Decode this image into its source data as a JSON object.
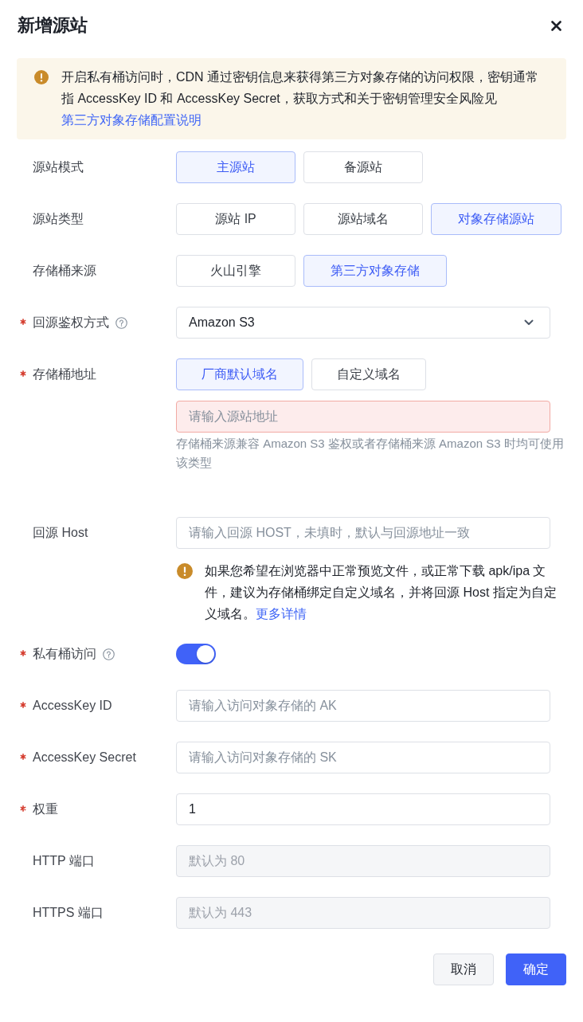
{
  "dialog": {
    "title": "新增源站"
  },
  "notice": {
    "text": "开启私有桶访问时，CDN 通过密钥信息来获得第三方对象存储的访问权限，密钥通常指 AccessKey ID 和 AccessKey Secret，获取方式和关于密钥管理安全风险见",
    "link": "第三方对象存储配置说明"
  },
  "fields": [
    {
      "kind": "segmented",
      "label": "源站模式",
      "required": false,
      "help": false,
      "options": [
        {
          "label": "主源站",
          "selected": true
        },
        {
          "label": "备源站",
          "selected": false
        }
      ]
    },
    {
      "kind": "segmented",
      "label": "源站类型",
      "required": false,
      "help": false,
      "options": [
        {
          "label": "源站 IP",
          "selected": false
        },
        {
          "label": "源站域名",
          "selected": false
        },
        {
          "label": "对象存储源站",
          "selected": true
        }
      ]
    },
    {
      "kind": "segmented",
      "label": "存储桶来源",
      "required": false,
      "help": false,
      "options": [
        {
          "label": "火山引擎",
          "selected": false
        },
        {
          "label": "第三方对象存储",
          "selected": true
        }
      ]
    },
    {
      "kind": "select",
      "label": "回源鉴权方式",
      "required": true,
      "help": true,
      "value": "Amazon S3"
    },
    {
      "kind": "segmented-input",
      "label": "存储桶地址",
      "required": true,
      "help": false,
      "options": [
        {
          "label": "厂商默认域名",
          "selected": true
        },
        {
          "label": "自定义域名",
          "selected": false
        }
      ],
      "input": {
        "placeholder": "请输入源站地址",
        "error": true
      },
      "hint": "存储桶来源兼容 Amazon S3 鉴权或者存储桶来源 Amazon S3 时均可使用该类型"
    },
    {
      "kind": "input",
      "label": "回源 Host",
      "required": false,
      "help": false,
      "placeholder": "请输入回源 HOST，未填时，默认与回源地址一致",
      "disabled": false,
      "notice": {
        "text": "如果您希望在浏览器中正常预览文件，或正常下载 apk/ipa 文件，建议为存储桶绑定自定义域名，并将回源 Host 指定为自定义域名。",
        "link": "更多详情"
      }
    },
    {
      "kind": "switch",
      "label": "私有桶访问",
      "required": true,
      "help": true,
      "on": true
    },
    {
      "kind": "input",
      "label": "AccessKey ID",
      "required": true,
      "help": false,
      "placeholder": "请输入访问对象存储的 AK",
      "disabled": false
    },
    {
      "kind": "input",
      "label": "AccessKey Secret",
      "required": true,
      "help": false,
      "placeholder": "请输入访问对象存储的 SK",
      "disabled": false
    },
    {
      "kind": "input",
      "label": "权重",
      "required": true,
      "help": false,
      "value": "1",
      "disabled": false
    },
    {
      "kind": "input",
      "label": "HTTP 端口",
      "required": false,
      "help": false,
      "placeholder": "默认为 80",
      "disabled": true
    },
    {
      "kind": "input",
      "label": "HTTPS 端口",
      "required": false,
      "help": false,
      "placeholder": "默认为 443",
      "disabled": true
    }
  ],
  "buttons": [
    {
      "label": "取消",
      "kind": "secondary"
    },
    {
      "label": "确定",
      "kind": "primary"
    }
  ]
}
